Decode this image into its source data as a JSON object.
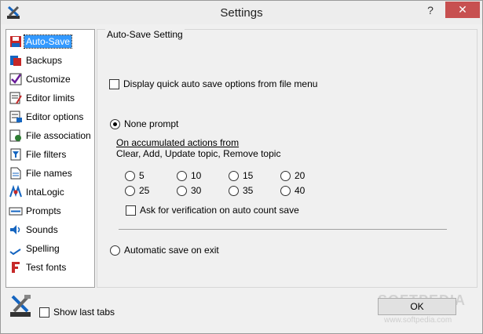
{
  "window": {
    "title": "Settings",
    "help_label": "?",
    "close_label": "✕"
  },
  "sidebar": {
    "items": [
      {
        "label": "Auto-Save",
        "icon": "floppy-icon",
        "selected": true
      },
      {
        "label": "Backups",
        "icon": "backup-icon"
      },
      {
        "label": "Customize",
        "icon": "checkmark-icon"
      },
      {
        "label": "Editor limits",
        "icon": "editor-limits-icon"
      },
      {
        "label": "Editor options",
        "icon": "editor-options-icon"
      },
      {
        "label": "File association",
        "icon": "file-association-icon"
      },
      {
        "label": "File filters",
        "icon": "file-filters-icon"
      },
      {
        "label": "File names",
        "icon": "file-names-icon"
      },
      {
        "label": "IntaLogic",
        "icon": "intalogic-icon"
      },
      {
        "label": "Prompts",
        "icon": "prompts-icon"
      },
      {
        "label": "Sounds",
        "icon": "speaker-icon"
      },
      {
        "label": "Spelling",
        "icon": "spelling-icon"
      },
      {
        "label": "Test fonts",
        "icon": "font-icon"
      }
    ]
  },
  "autosave": {
    "group_title": "Auto-Save Setting",
    "display_quick_label": "Display quick auto save options from file menu",
    "none_prompt_label": "None prompt",
    "accumulated_label": "On accumulated actions from",
    "accumulated_desc": "Clear, Add, Update topic, Remove topic",
    "counts": [
      "5",
      "10",
      "15",
      "20",
      "25",
      "30",
      "35",
      "40"
    ],
    "ask_verification_label": "Ask for verification on auto count save",
    "auto_save_exit_label": "Automatic save on exit"
  },
  "footer": {
    "show_last_tabs_label": "Show last tabs",
    "ok_label": "OK"
  },
  "watermark": {
    "text": "SOFTPEDIA",
    "url": "www.softpedia.com"
  }
}
